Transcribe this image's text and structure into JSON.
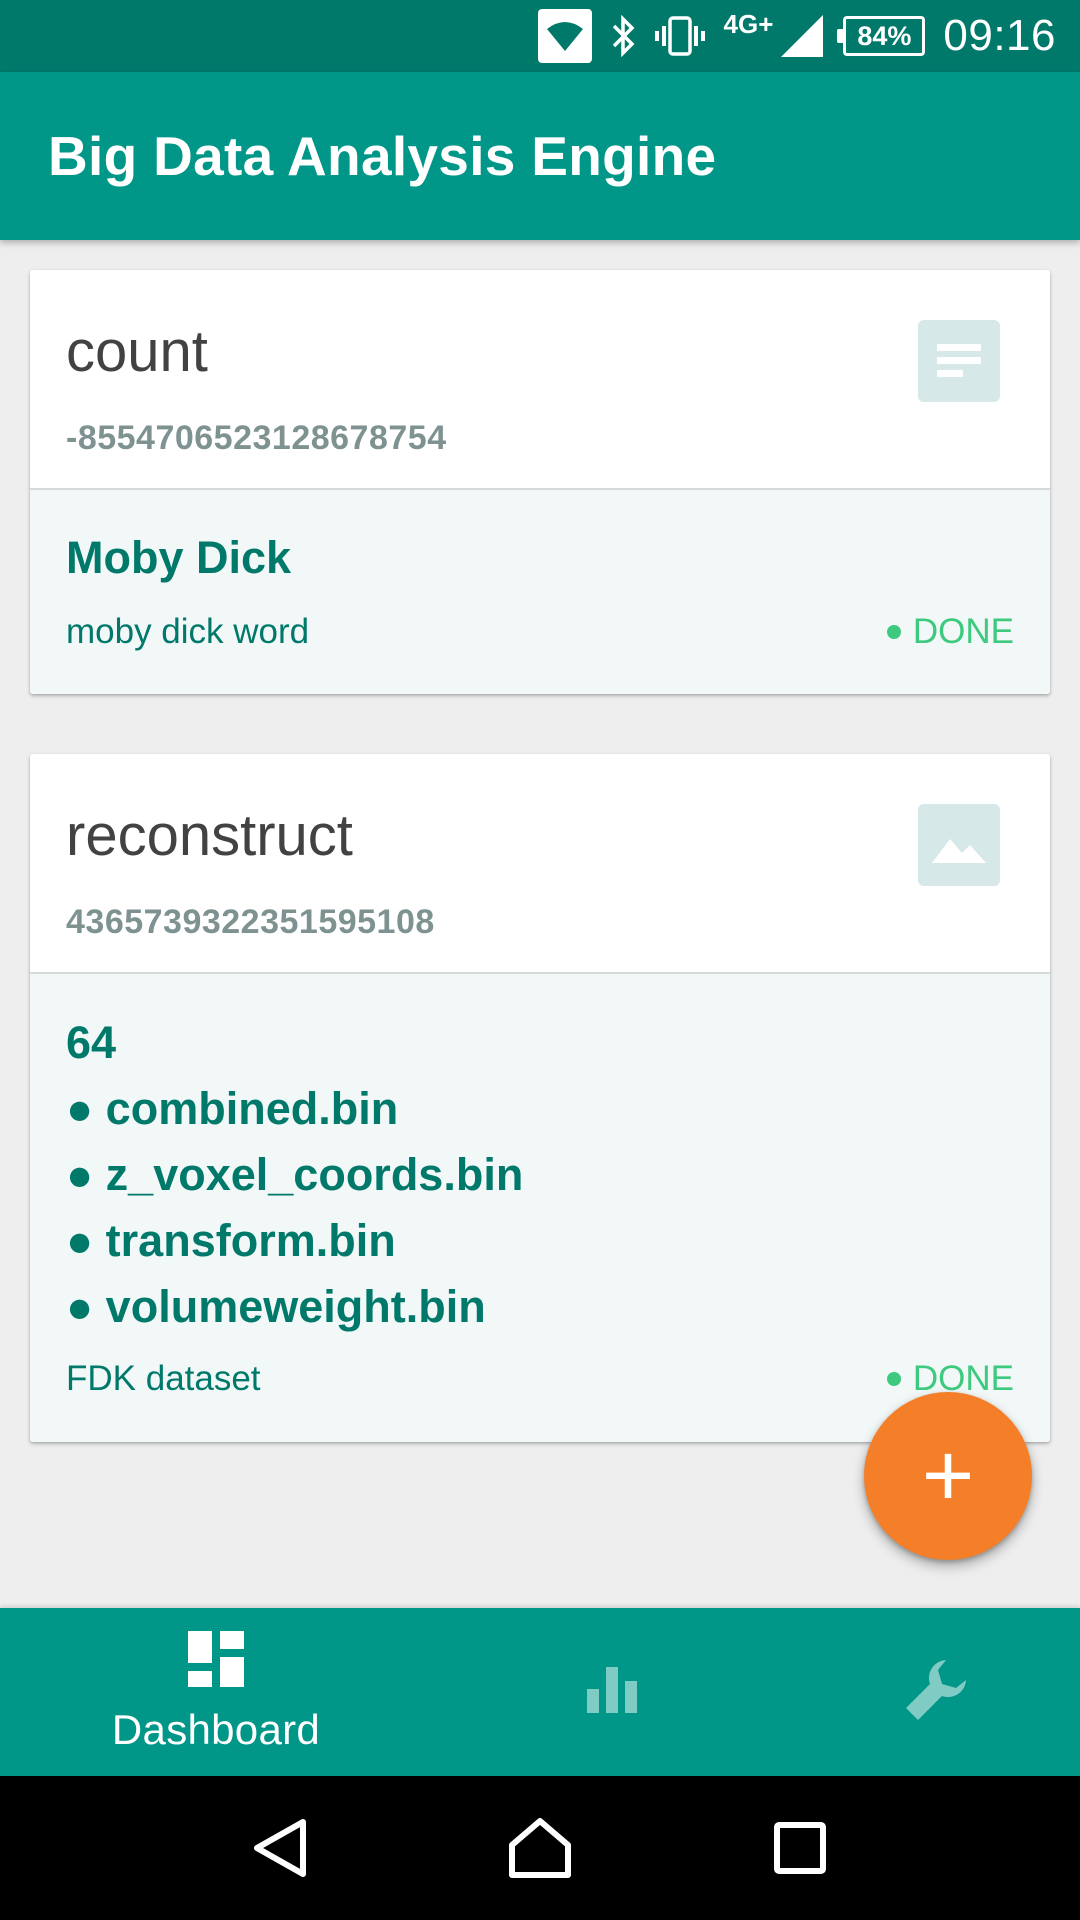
{
  "status_bar": {
    "network": "4G+",
    "battery": "84%",
    "time": "09:16"
  },
  "app_bar": {
    "title": "Big Data Analysis Engine"
  },
  "cards": [
    {
      "name": "count",
      "id": "-8554706523128678754",
      "thumbnail_icon": "document-icon",
      "headline": "Moby Dick",
      "lines": [],
      "description": "moby dick word",
      "status": "DONE"
    },
    {
      "name": "reconstruct",
      "id": "4365739322351595108",
      "thumbnail_icon": "image-icon",
      "headline": "64",
      "lines": [
        "● combined.bin",
        "● z_voxel_coords.bin",
        "● transform.bin",
        "● volumeweight.bin"
      ],
      "description": "FDK dataset",
      "status": "DONE"
    }
  ],
  "fab": {
    "label": "+"
  },
  "bottom_nav": {
    "items": [
      {
        "label": "Dashboard",
        "icon": "dashboard-icon",
        "active": true
      },
      {
        "label": "",
        "icon": "bar-chart-icon",
        "active": false
      },
      {
        "label": "",
        "icon": "wrench-icon",
        "active": false
      }
    ]
  },
  "colors": {
    "primary": "#009688",
    "primary_dark": "#00796b",
    "accent": "#f57f28",
    "done": "#3dca7e"
  }
}
